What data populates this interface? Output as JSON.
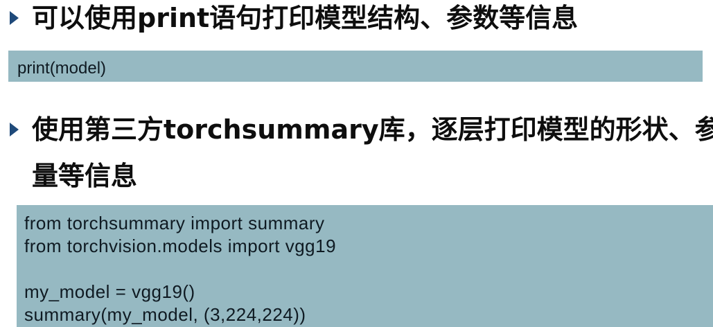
{
  "bullets": [
    {
      "text": "可以使用print语句打印模型结构、参数等信息",
      "code": [
        "print(model)"
      ]
    },
    {
      "text_line1": "使用第三方torchsummary库，逐层打印模型的形状、参数",
      "text_line2": "量等信息",
      "code": [
        "from torchsummary import summary",
        "from torchvision.models import vgg19",
        "",
        "my_model = vgg19()",
        "summary(my_model, (3,224,224))"
      ]
    }
  ],
  "colors": {
    "code_background": "#96b9c2",
    "bullet": "#1f4a7a",
    "text": "#0e0e0e"
  },
  "icons": {
    "bullet": "triangle-right-icon"
  }
}
